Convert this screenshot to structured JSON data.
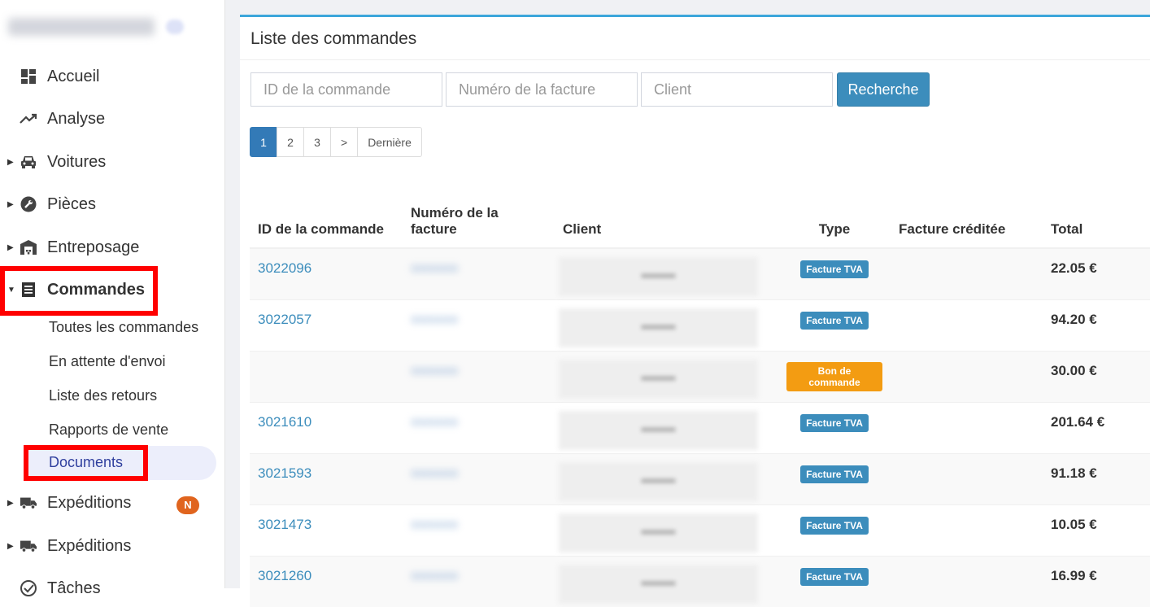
{
  "sidebar": {
    "nav": [
      {
        "label": "Accueil",
        "icon": "dashboard-icon",
        "caret": false
      },
      {
        "label": "Analyse",
        "icon": "trending-up-icon",
        "caret": false
      },
      {
        "label": "Voitures",
        "icon": "car-icon",
        "caret": true
      },
      {
        "label": "Pièces",
        "icon": "wrench-icon",
        "caret": true
      },
      {
        "label": "Entreposage",
        "icon": "warehouse-icon",
        "caret": true
      },
      {
        "label": "Commandes",
        "icon": "list-icon",
        "caret": true,
        "expanded": true
      }
    ],
    "sub": [
      {
        "label": "Toutes les commandes"
      },
      {
        "label": "En attente d'envoi"
      },
      {
        "label": "Liste des retours"
      },
      {
        "label": "Rapports de vente"
      },
      {
        "label": "Documents",
        "active": true
      }
    ],
    "nav_after": [
      {
        "label": "Expéditions",
        "icon": "truck-icon",
        "badge": "N"
      },
      {
        "label": "Expéditions",
        "icon": "truck-icon"
      },
      {
        "label": "Tâches",
        "icon": "check-circle-icon"
      }
    ]
  },
  "panel": {
    "title": "Liste des commandes",
    "search": {
      "order_id_placeholder": "ID de la commande",
      "invoice_placeholder": "Numéro de la facture",
      "client_placeholder": "Client",
      "button": "Recherche"
    },
    "pagination": [
      "1",
      "2",
      "3",
      ">",
      "Dernière"
    ],
    "table": {
      "headers": [
        "ID de la commande",
        "Numéro de la facture",
        "Client",
        "Type",
        "Facture créditée",
        "Total"
      ],
      "rows": [
        {
          "id": "3022096",
          "type": "Facture TVA",
          "type_color": "blue",
          "credited": "",
          "total": "22.05 €"
        },
        {
          "id": "3022057",
          "type": "Facture TVA",
          "type_color": "blue",
          "credited": "",
          "total": "94.20 €"
        },
        {
          "id": "",
          "type": "Bon de commande",
          "type_color": "orange",
          "credited": "",
          "total": "30.00 €"
        },
        {
          "id": "3021610",
          "type": "Facture TVA",
          "type_color": "blue",
          "credited": "",
          "total": "201.64 €"
        },
        {
          "id": "3021593",
          "type": "Facture TVA",
          "type_color": "blue",
          "credited": "",
          "total": "91.18 €"
        },
        {
          "id": "3021473",
          "type": "Facture TVA",
          "type_color": "blue",
          "credited": "",
          "total": "10.05 €"
        },
        {
          "id": "3021260",
          "type": "Facture TVA",
          "type_color": "blue",
          "credited": "",
          "total": "16.99 €"
        }
      ]
    }
  },
  "colors": {
    "accent": "#3c8dbc",
    "highlight": "#ff0000",
    "badge": "#e0641e",
    "label_orange": "#f39c12"
  }
}
